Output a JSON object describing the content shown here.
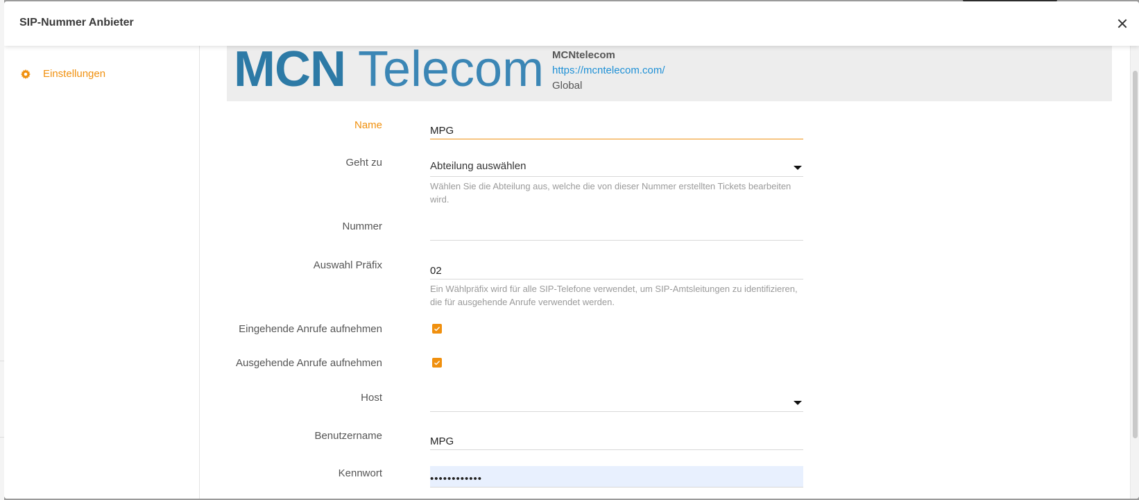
{
  "modal": {
    "title": "SIP-Nummer Anbieter"
  },
  "sidebar": {
    "items": [
      {
        "label": "Einstellungen",
        "icon": "gear-icon"
      }
    ]
  },
  "provider": {
    "logo_part1": "MCN",
    "logo_part2": "Telecom",
    "name": "MCNtelecom",
    "url": "https://mcntelecom.com/",
    "scope": "Global"
  },
  "form": {
    "name": {
      "label": "Name",
      "value": "MPG"
    },
    "geht_zu": {
      "label": "Geht zu",
      "value": "Abteilung auswählen",
      "helper": "Wählen Sie die Abteilung aus, welche die von dieser Nummer erstellten Tickets bearbeiten wird."
    },
    "nummer": {
      "label": "Nummer",
      "value": ""
    },
    "auswahl_praefix": {
      "label": "Auswahl Präfix",
      "value": "02",
      "helper": "Ein Wählpräfix wird für alle SIP-Telefone verwendet, um SIP-Amtsleitungen zu identifizieren, die für ausgehende Anrufe verwendet werden."
    },
    "eingehende": {
      "label": "Eingehende Anrufe aufnehmen",
      "checked": true
    },
    "ausgehende": {
      "label": "Ausgehende Anrufe aufnehmen",
      "checked": true
    },
    "host": {
      "label": "Host",
      "value": ""
    },
    "benutzername": {
      "label": "Benutzername",
      "value": "MPG"
    },
    "kennwort": {
      "label": "Kennwort",
      "value": "••••••••••••"
    }
  },
  "colors": {
    "accent": "#f0900e",
    "link": "#1e90d6",
    "logo": "#2d7aa6"
  }
}
